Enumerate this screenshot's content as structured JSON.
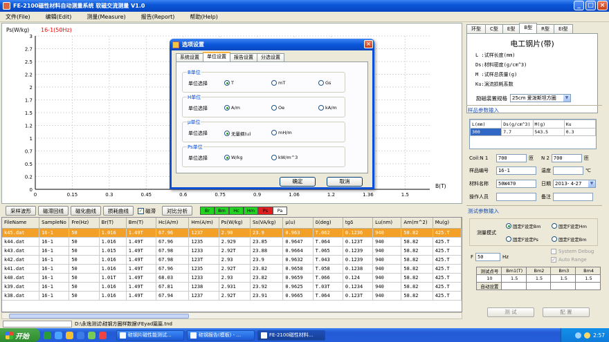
{
  "window": {
    "title": "FE-2100磁性材料自动测量系统  软磁交流测量  V1.0",
    "minimize": "_",
    "maximize": "□",
    "close": "×"
  },
  "menu": [
    "文件(File)",
    "编辑(Edit)",
    "测量(Measure)",
    "报告(Report)",
    "帮助(Help)"
  ],
  "plot": {
    "ylabel": "Ps(W/kg)",
    "series_label": "16-1(50Hz)",
    "xlabel": "B(T)",
    "series_color": "#ff0000"
  },
  "chart_data": {
    "type": "line",
    "xlabel": "B(T)",
    "ylabel": "Ps(W/kg)",
    "xlim": [
      0,
      1.6
    ],
    "ylim": [
      0,
      3
    ],
    "x_ticks": [
      "0",
      "0.15",
      "0.3",
      "0.45",
      "0.6",
      "0.75",
      "0.9",
      "1.06",
      "1.2",
      "1.36",
      "1.5"
    ],
    "y_ticks": [
      "0",
      "0.2",
      "0.5",
      "0.7",
      "1",
      "1.2",
      "1.5",
      "1.7",
      "2",
      "2.2",
      "2.5",
      "2.7",
      "3"
    ],
    "grid": true,
    "series": [
      {
        "name": "16-1(50Hz)",
        "x": [],
        "y": []
      }
    ]
  },
  "toolbar": {
    "buttons": [
      "采样波形",
      "磁滞回线",
      "磁化曲线",
      "损耗曲线",
      "对比分析"
    ],
    "checkbox_label": "磁滞",
    "checkbox_mark": "✓",
    "indicators": [
      {
        "label": "Br",
        "color": "#22d322"
      },
      {
        "label": "Bm",
        "color": "#22d322"
      },
      {
        "label": "Hc",
        "color": "#22d322"
      },
      {
        "label": "Hm",
        "color": "#22d322"
      },
      {
        "label": "Ps",
        "color": "#e02020"
      },
      {
        "label": "Pa",
        "color": "#ffffff"
      }
    ]
  },
  "table": {
    "columns": [
      "FileName",
      "SampleNo",
      "Fre(Hz)",
      "Br(T)",
      "Bm(T)",
      "Hc(A/m)",
      "Hm(A/m)",
      "Ps(W/kg)",
      "Ss(VA/kg)",
      "μ(u)",
      "δ(deg)",
      "tgδ",
      "Lu(nm)",
      "Am(m^2)",
      "Mu(g)"
    ],
    "rows": [
      [
        "k45.dat",
        "16-1",
        "50",
        "1.016",
        "1.49T",
        "67.96",
        "1237",
        "2.90",
        "23.9",
        "0.963",
        "T.062",
        "0.1236",
        "940",
        "58.82",
        "425.T"
      ],
      [
        "k44.dat",
        "16-1",
        "50",
        "1.016",
        "1.49T",
        "67.96",
        "1235",
        "2.929",
        "23.85",
        "0.9647",
        "T.064",
        "0.123T",
        "940",
        "58.82",
        "425.T"
      ],
      [
        "k43.dat",
        "16-1",
        "50",
        "1.015",
        "1.49T",
        "67.98",
        "1233",
        "2.92T",
        "23.88",
        "0.9664",
        "T.065",
        "0.1239",
        "940",
        "58.82",
        "425.T"
      ],
      [
        "k42.dat",
        "16-1",
        "50",
        "1.016",
        "1.49T",
        "67.98",
        "123T",
        "2.93",
        "23.9",
        "0.9632",
        "T.043",
        "0.1239",
        "940",
        "58.82",
        "425.T"
      ],
      [
        "k41.dat",
        "16-1",
        "50",
        "1.016",
        "1.49T",
        "67.96",
        "1235",
        "2.92T",
        "23.82",
        "0.9658",
        "T.058",
        "0.1238",
        "940",
        "58.82",
        "425.T"
      ],
      [
        "k40.dat",
        "16-1",
        "50",
        "1.01T",
        "1.49T",
        "68.03",
        "1233",
        "2.93",
        "23.82",
        "0.9659",
        "T.066",
        "0.124",
        "940",
        "58.82",
        "425.T"
      ],
      [
        "k39.dat",
        "16-1",
        "50",
        "1.016",
        "1.49T",
        "67.81",
        "1238",
        "2.931",
        "23.92",
        "0.9625",
        "T.03T",
        "0.1234",
        "940",
        "58.82",
        "425.T"
      ],
      [
        "k38.dat",
        "16-1",
        "50",
        "1.016",
        "1.49T",
        "67.94",
        "1237",
        "2.92T",
        "23.91",
        "0.9665",
        "T.064",
        "0.123T",
        "940",
        "58.82",
        "425.T"
      ]
    ]
  },
  "status": {
    "path": "D:\\永逸测试\\硅钢方圈样数据\\FEyad篇篇.tnd"
  },
  "right_panel": {
    "tabs": [
      "环型",
      "C型",
      "E型",
      "B型",
      "R型",
      "EI型"
    ],
    "active_tab": 3,
    "sample_title": "电工钢片(带)",
    "sample_lines": [
      "L :试样长度(mm)",
      "Ds:材料密度(g/cm^3)",
      "M :试样总质量(g)",
      "Ku:涡流损耗系数"
    ],
    "spec_label": "励磁装置规格",
    "spec_value": "25cm 爱泼斯坦方圈",
    "sample_params_title": "样品参数输入",
    "params_headers": [
      "L(mm)",
      "Ds(g/cm^3)",
      "M(g)",
      "Ku"
    ],
    "params_values": [
      "300",
      "7.7",
      "543.5",
      "0.3"
    ],
    "coil_n1_label": "Coil:N 1",
    "coil_n1_value": "700",
    "coil_n1_unit": "匝",
    "coil_n2_label": "N 2",
    "coil_n2_value": "700",
    "coil_n2_unit": "匝",
    "sample_no_label": "样品编号",
    "sample_no_value": "16-1",
    "temp_label": "温度",
    "temp_unit": "℃",
    "material_label": "材料名称",
    "material_value": "50W470",
    "date_label": "日期",
    "date_value": "2013- 4-27",
    "operator_label": "操作人员",
    "note_label": "备注",
    "test_params_title": "测试参数输入",
    "mode_label": "测量模式",
    "mode_options": [
      "固定F设定Bm",
      "固定F设定Hm",
      "固定F设定Ps",
      "固定F设定Bm"
    ],
    "system_debug": "System Debug",
    "auto_range": "Auto Range",
    "f_label": "F",
    "f_value": "50",
    "f_unit": "Hz",
    "measure_headers": [
      "测试点号",
      "Bm1(T)",
      "Bm2",
      "Bm3",
      "Bm4"
    ],
    "measure_values": [
      "10",
      "1.5",
      "1.5",
      "1.5",
      "1.5"
    ],
    "auto_set_label": "自动设置",
    "test_button": "测 试",
    "config_button": "配 置"
  },
  "dialog": {
    "title": "选项设置",
    "tabs": [
      "系统设置",
      "单位设置",
      "报告设置",
      "分选设置"
    ],
    "active_tab": 1,
    "groups": [
      {
        "title": "B单位",
        "label": "单位选择",
        "options": [
          "T",
          "mT",
          "Gs"
        ],
        "selected": 0
      },
      {
        "title": "H单位",
        "label": "单位选择",
        "options": [
          "A/m",
          "Oe",
          "kA/m"
        ],
        "selected": 0
      },
      {
        "title": "μ单位",
        "label": "单位选择",
        "options": [
          "无量纲(u)",
          "mH/m"
        ],
        "selected": 0
      },
      {
        "title": "Ps单位",
        "label": "单位选择",
        "options": [
          "W/kg",
          "kW/m^3"
        ],
        "selected": 0
      }
    ],
    "ok": "确定",
    "cancel": "取消"
  },
  "taskbar": {
    "start": "开始",
    "tasks": [
      "硅钢片磁性能测试...",
      "硅钢报告(模板) - ...",
      "FE-2100磁性材料..."
    ],
    "clock": "2:57"
  }
}
